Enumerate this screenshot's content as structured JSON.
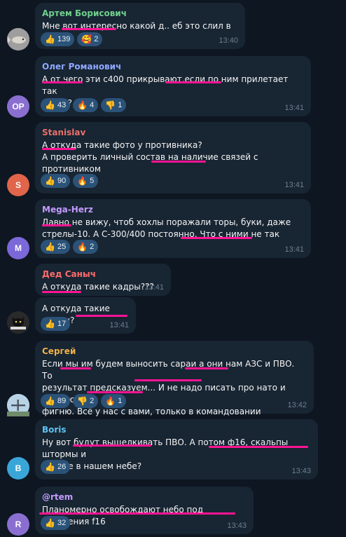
{
  "colors": {
    "background": "#0e1621",
    "bubble": "#182533",
    "reaction_pill": "#2b5278",
    "timestamp": "#6d7f8f",
    "highlight_underline": "#ff1493"
  },
  "messages": [
    {
      "author": "Артем Борисович",
      "author_color": "#6fd08c",
      "avatar": {
        "initials": "",
        "color": "#8a8a8a",
        "icon": "fish-photo-avatar"
      },
      "lines": [
        "Мне вот интересно какой д.. еб это слил в сеть🤔"
      ],
      "reactions": [
        {
          "emoji": "👍",
          "count": "139"
        },
        {
          "emoji": "🥰",
          "count": "2"
        }
      ],
      "time": "13:40"
    },
    {
      "author": "Олег Романович",
      "author_color": "#8fa8ff",
      "avatar": {
        "initials": "OP",
        "color": "#8a6fd1"
      },
      "lines": [
        "А от чего эти с400 прикрывают,если по ним прилетает так",
        "точно?"
      ],
      "reactions": [
        {
          "emoji": "👍",
          "count": "43"
        },
        {
          "emoji": "🔥",
          "count": "4"
        },
        {
          "emoji": "👎",
          "count": "1"
        }
      ],
      "time": "13:41"
    },
    {
      "author": "Stanislav",
      "author_color": "#e8706a",
      "avatar": {
        "initials": "S",
        "color": "#e0654a"
      },
      "lines": [
        "А откуда такие фото у противника?",
        "А проверить личный состав на наличие связей с противником",
        "🤔"
      ],
      "reactions": [
        {
          "emoji": "👍",
          "count": "90"
        },
        {
          "emoji": "🔥",
          "count": "5"
        }
      ],
      "time": "13:41"
    },
    {
      "author": "Mega-Herz",
      "author_color": "#c39bff",
      "avatar": {
        "initials": "M",
        "color": "#7b68d9"
      },
      "lines": [
        "Давно не вижу, чтоб хохлы поражали торы, буки, даже",
        "стрелы-10. А С-300/400 постоянно. Что с ними не так"
      ],
      "reactions": [
        {
          "emoji": "👍",
          "count": "25"
        },
        {
          "emoji": "🔥",
          "count": "2"
        }
      ],
      "time": "13:41"
    },
    {
      "author": "Дед Саныч",
      "author_color": "#ff6b6b",
      "avatar": null,
      "lines": [
        "А откуда такие кадры???"
      ],
      "reactions": [],
      "time": "13:41"
    },
    {
      "author": "",
      "author_color": "",
      "avatar": {
        "initials": "",
        "color": "#2a2a2a",
        "icon": "cat-meme-avatar",
        "caption": "ТЕМ КОГО ТЫ НЕ ПОКАЖЕШЬ"
      },
      "lines": [
        "А откуда такие кадры?"
      ],
      "reactions": [
        {
          "emoji": "👍",
          "count": "17"
        }
      ],
      "time": "13:41"
    },
    {
      "author": "Сергей",
      "author_color": "#f0b24a",
      "avatar": {
        "initials": "",
        "color": "#a7c3d8",
        "icon": "aircraft-photo-avatar"
      },
      "lines": [
        "Если мы им будем выносить сараи а они нам АЗС и ПВО. То",
        "результат предсказуем... И не надо писать про нато и прочую",
        "фигню. Всё у нас с вами, только в командовании проблемы."
      ],
      "reactions": [
        {
          "emoji": "👍",
          "count": "89"
        },
        {
          "emoji": "👎",
          "count": "2"
        },
        {
          "emoji": "🔥",
          "count": "1"
        }
      ],
      "time": "13:42"
    },
    {
      "author": "Boris",
      "author_color": "#5fc4f2",
      "avatar": {
        "initials": "B",
        "color": "#3aa6d8"
      },
      "lines": [
        "Ну вот будут выщелкивать ПВО. А потом ф16, скальпы штормы и",
        "прочее в нашем небе?"
      ],
      "reactions": [
        {
          "emoji": "👍",
          "count": "26"
        }
      ],
      "time": "13:43"
    },
    {
      "author": "@rtem",
      "author_color": "#c39bff",
      "avatar": {
        "initials": "R",
        "color": "#8a6fd1"
      },
      "lines": [
        "Планомерно освобождают небо под появления f16"
      ],
      "reactions": [
        {
          "emoji": "👍",
          "count": "32"
        }
      ],
      "time": "13:43"
    }
  ]
}
